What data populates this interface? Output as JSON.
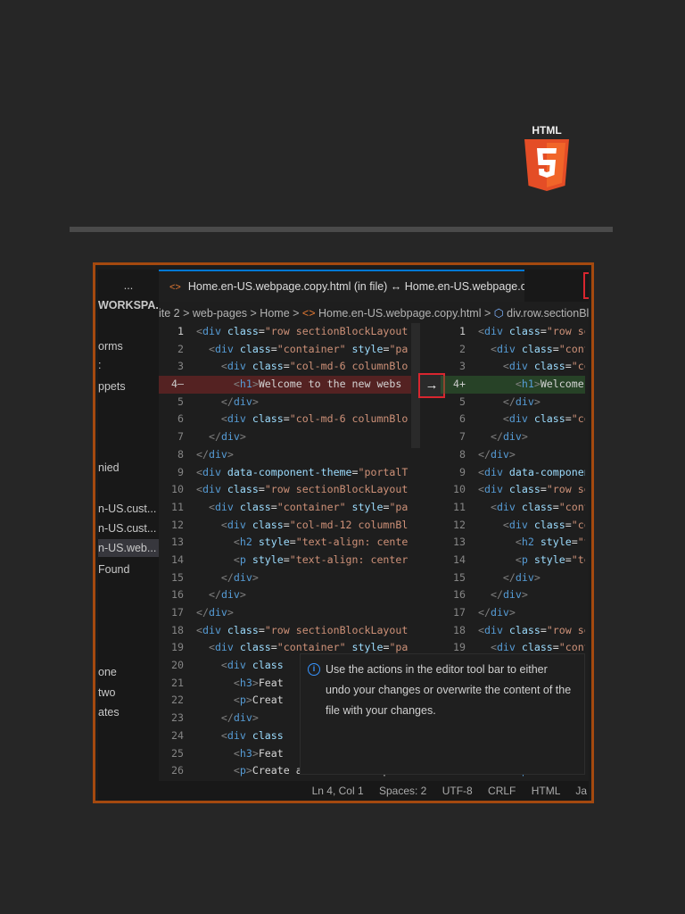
{
  "logo": {
    "text": "HTML",
    "number": "5"
  },
  "sidebar": {
    "more": "...",
    "items": [
      "WORKSPA...",
      "orms",
      ":",
      "ppets",
      "nied",
      "n-US.cust...",
      "n-US.cust...",
      "n-US.web...",
      "Found",
      "one",
      "two",
      "ates"
    ]
  },
  "tab": {
    "title": "Home.en-US.webpage.copy.html (in file) ↔ Home.en-US.webpage.copy.html"
  },
  "actions": {
    "accept": "✓",
    "revert": "⤾",
    "up": "↑"
  },
  "breadcrumb": {
    "items": [
      "ite 2",
      "web-pages",
      "Home",
      "Home.en-US.webpage.copy.html",
      "div.row.sectionBlockLayout"
    ]
  },
  "editor": {
    "left": [
      "<div class=\"row sectionBlockLayout",
      "  <div class=\"container\" style=\"pa",
      "    <div class=\"col-md-6 columnBlo",
      "      <h1>Welcome to the new webs",
      "    </div>",
      "    <div class=\"col-md-6 columnBlo",
      "  </div>",
      "</div>",
      "<div data-component-theme=\"portalT",
      "<div class=\"row sectionBlockLayout",
      "  <div class=\"container\" style=\"pa",
      "    <div class=\"col-md-12 columnBl",
      "      <h2 style=\"text-align: cente",
      "      <p style=\"text-align: center",
      "    </div>",
      "  </div>",
      "</div>",
      "<div class=\"row sectionBlockLayout",
      "  <div class=\"container\" style=\"pa",
      "    <div class",
      "      <h3>Feat",
      "      <p>Creat",
      "    </div>",
      "    <div class",
      "      <h3>Feat",
      "      <p>Create a short descriptio"
    ],
    "right": [
      "<div class=\"row se",
      "  <div class=\"cont",
      "    <div class=\"co",
      "      <h1>Welcome",
      "    </div>",
      "    <div class=\"co",
      "  </div>",
      "</div>",
      "<div data-componen",
      "<div class=\"row se",
      "  <div class=\"cont",
      "    <div class=\"co",
      "      <h2 style=\"t",
      "      <p style=\"te",
      "    </div>",
      "  </div>",
      "</div>",
      "<div class=\"row se",
      "  <div class=\"cont",
      "",
      "",
      "",
      "",
      "",
      "",
      "      <p>Create a"
    ],
    "changed_line": 4,
    "arrow": "→"
  },
  "tooltip": {
    "text": "Use the actions in the editor tool bar to either undo your changes or overwrite the content of the file with your changes."
  },
  "status": {
    "position": "Ln 4, Col 1",
    "spaces": "Spaces: 2",
    "encoding": "UTF-8",
    "eol": "CRLF",
    "language": "HTML",
    "extra": "Ja"
  }
}
